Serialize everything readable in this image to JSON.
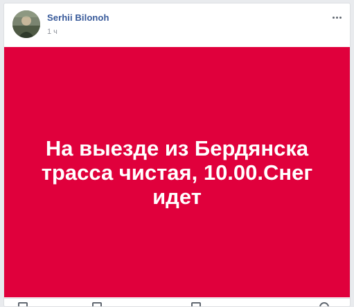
{
  "post": {
    "author": "Serhii Bilonoh",
    "time": "1 ч",
    "text": "На выезде из Бердянска трасса чистая, 10.00.Снег идет",
    "background_color": "#e0003c"
  },
  "icons": {
    "more": "more-options-icon",
    "like": "like-icon",
    "comment": "comment-icon",
    "share": "share-icon"
  }
}
